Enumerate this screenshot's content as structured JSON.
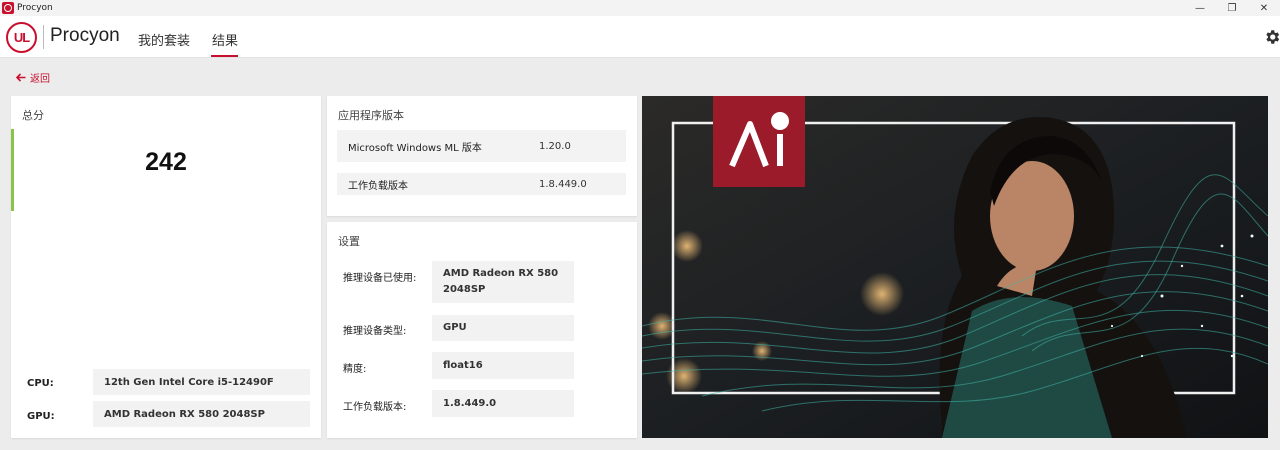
{
  "window": {
    "title": "Procyon",
    "minimize": "—",
    "restore": "❐",
    "close": "✕"
  },
  "header": {
    "logo_text": "UL",
    "brand": "Procyon",
    "tabs": [
      {
        "label": "我的套装"
      },
      {
        "label": "结果"
      }
    ]
  },
  "back": {
    "label": "返回"
  },
  "score": {
    "title": "总分",
    "value": "242",
    "cpu_label": "CPU:",
    "cpu_value": "12th Gen Intel Core i5-12490F",
    "gpu_label": "GPU:",
    "gpu_value": "AMD Radeon RX 580 2048SP"
  },
  "app_version": {
    "title": "应用程序版本",
    "rows": [
      {
        "key": "Microsoft Windows ML 版本",
        "value": "1.20.0"
      },
      {
        "key": "工作负载版本",
        "value": "1.8.449.0"
      }
    ]
  },
  "settings": {
    "title": "设置",
    "rows": [
      {
        "key": "推理设备已使用:",
        "value_line1": "AMD Radeon RX 580",
        "value_line2": "2048SP"
      },
      {
        "key": "推理设备类型:",
        "value": "GPU"
      },
      {
        "key": "精度:",
        "value": "float16"
      },
      {
        "key": "工作负载版本:",
        "value": "1.8.449.0"
      }
    ]
  },
  "hero": {
    "badge_icon": "ai-logo-badge",
    "image": "woman-thinking-with-data-waves"
  },
  "colors": {
    "accent": "#c8102e",
    "score_bar": "#8bc34a",
    "hero_teal": "#3fb4a8"
  }
}
